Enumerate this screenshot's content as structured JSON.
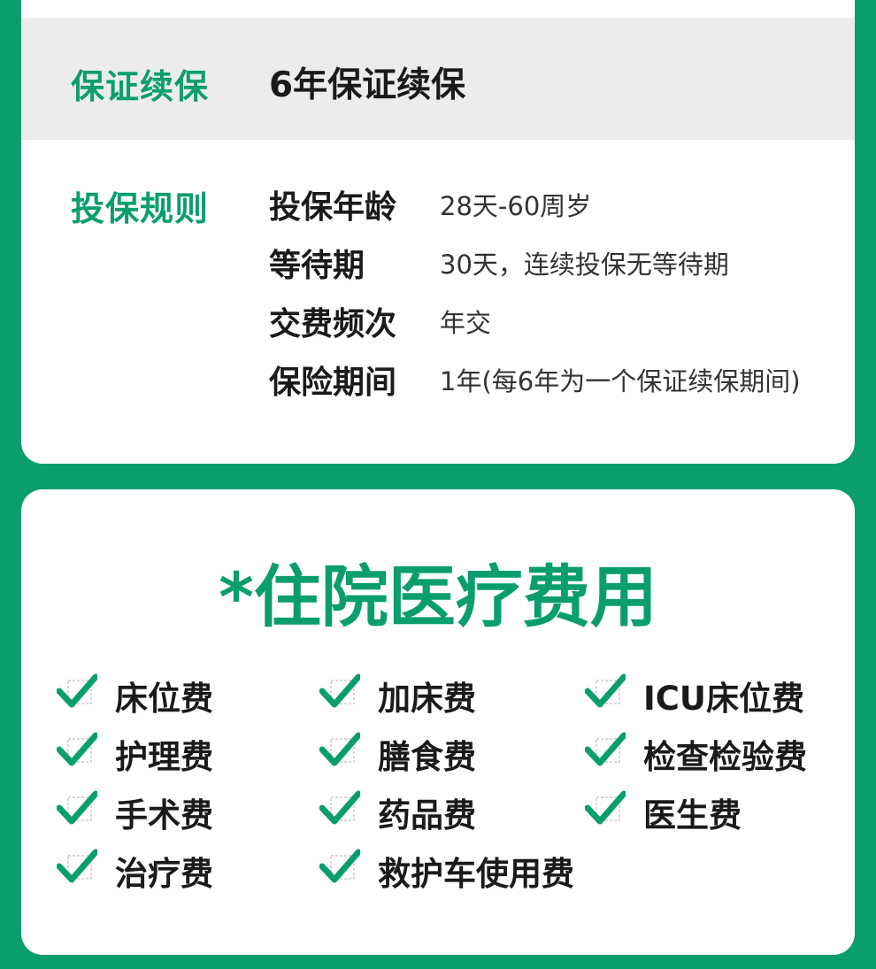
{
  "renewal": {
    "label": "保证续保",
    "value": "6年保证续保"
  },
  "rules": {
    "label": "投保规则",
    "items": [
      {
        "key": "投保年龄",
        "value": "28天-60周岁"
      },
      {
        "key": "等待期",
        "value": "30天，连续投保无等待期"
      },
      {
        "key": "交费频次",
        "value": "年交"
      },
      {
        "key": "保险期间",
        "value": "1年(每6年为一个保证续保期间)"
      }
    ]
  },
  "coverage": {
    "title": "*住院医疗费用",
    "check_icon": "check-icon",
    "items": [
      "床位费",
      "加床费",
      "ICU床位费",
      "护理费",
      "膳食费",
      "检查检验费",
      "手术费",
      "药品费",
      "医生费",
      "治疗费",
      "救护车使用费"
    ]
  },
  "colors": {
    "brand_green": "#0a9e6e",
    "row_gray": "#ececec",
    "check_box": "#d8d8d8"
  }
}
